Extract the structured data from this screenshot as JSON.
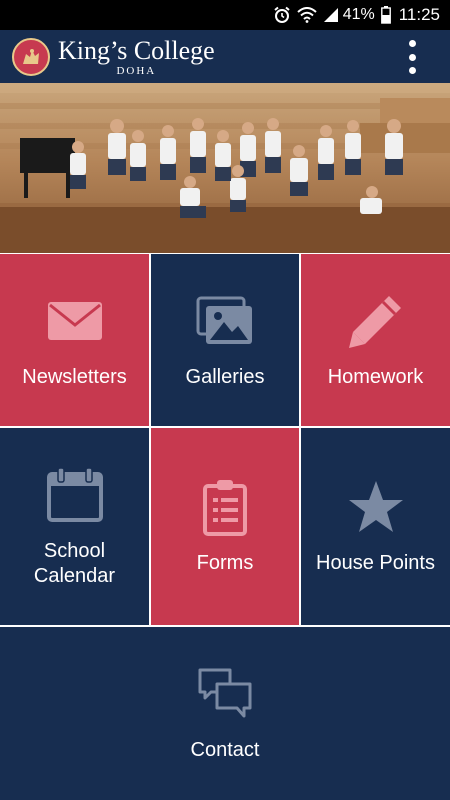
{
  "status_bar": {
    "battery_percent": "41%",
    "time": "11:25",
    "icons": [
      "alarm-icon",
      "wifi-icon",
      "signal-icon",
      "battery-icon"
    ]
  },
  "header": {
    "brand": "King’s College",
    "subtitle": "DOHA",
    "menu_icon": "more-vert-icon"
  },
  "hero": {
    "description": "School children group photo"
  },
  "tiles": [
    {
      "label": "Newsletters",
      "icon": "envelope-icon",
      "color": "#c7394f"
    },
    {
      "label": "Galleries",
      "icon": "images-icon",
      "color": "#172d50"
    },
    {
      "label": "Homework",
      "icon": "pencil-icon",
      "color": "#c7394f"
    },
    {
      "label": "School\nCalendar",
      "icon": "calendar-icon",
      "color": "#172d50"
    },
    {
      "label": "Forms",
      "icon": "clipboard-icon",
      "color": "#c7394f"
    },
    {
      "label": "House Points",
      "icon": "star-icon",
      "color": "#172d50"
    },
    {
      "label": "Contact",
      "icon": "chat-bubbles-icon",
      "color": "#172d50"
    }
  ],
  "colors": {
    "navy": "#172d50",
    "red": "#c7394f",
    "icon_light": "#7b8aa3"
  }
}
